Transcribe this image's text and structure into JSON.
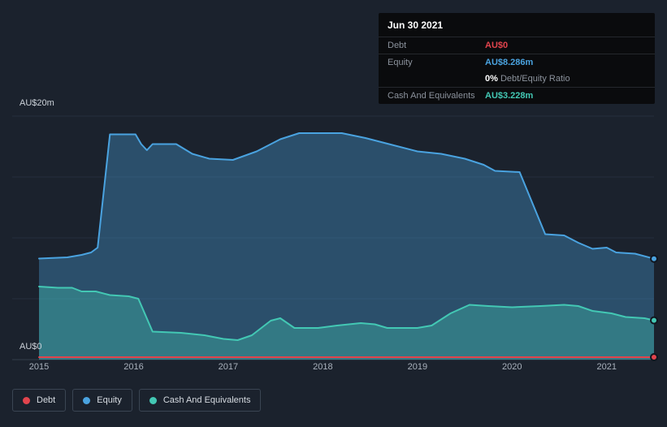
{
  "tooltip": {
    "date": "Jun 30 2021",
    "debt_label": "Debt",
    "debt_value": "AU$0",
    "equity_label": "Equity",
    "equity_value": "AU$8.286m",
    "ratio_value": "0%",
    "ratio_suffix": " Debt/Equity Ratio",
    "cash_label": "Cash And Equivalents",
    "cash_value": "AU$3.228m"
  },
  "axis": {
    "y_top_label": "AU$20m",
    "y_bottom_label": "AU$0",
    "x_ticks": [
      "2015",
      "2016",
      "2017",
      "2018",
      "2019",
      "2020",
      "2021"
    ]
  },
  "legend": [
    {
      "label": "Debt",
      "color": "#e2444d"
    },
    {
      "label": "Equity",
      "color": "#4aa3e0"
    },
    {
      "label": "Cash And Equivalents",
      "color": "#43c8b4"
    }
  ],
  "chart_data": {
    "type": "area",
    "x_range": [
      2015,
      2021.5
    ],
    "ylim": [
      0,
      20
    ],
    "y_unit": "AU$m",
    "gridline_values": [
      20,
      15,
      10,
      5,
      0
    ],
    "series": [
      {
        "name": "Equity",
        "slug": "equity",
        "color": "#4aa3e0",
        "fill": "rgba(74,163,224,0.35)",
        "x": [
          2015.0,
          2015.3,
          2015.45,
          2015.55,
          2015.62,
          2015.75,
          2016.02,
          2016.08,
          2016.14,
          2016.2,
          2016.45,
          2016.62,
          2016.8,
          2017.05,
          2017.3,
          2017.55,
          2017.75,
          2018.2,
          2018.45,
          2018.7,
          2019.0,
          2019.25,
          2019.5,
          2019.7,
          2019.82,
          2020.08,
          2020.35,
          2020.55,
          2020.7,
          2020.85,
          2021.0,
          2021.1,
          2021.3,
          2021.5
        ],
        "values": [
          8.3,
          8.4,
          8.6,
          8.8,
          9.2,
          18.5,
          18.5,
          17.7,
          17.2,
          17.7,
          17.7,
          16.9,
          16.5,
          16.4,
          17.1,
          18.1,
          18.6,
          18.6,
          18.2,
          17.7,
          17.1,
          16.9,
          16.5,
          16.0,
          15.5,
          15.4,
          10.3,
          10.2,
          9.6,
          9.1,
          9.2,
          8.8,
          8.7,
          8.286
        ]
      },
      {
        "name": "Cash And Equivalents",
        "slug": "cash",
        "color": "#43c8b4",
        "fill": "rgba(67,200,180,0.35)",
        "x": [
          2015.0,
          2015.2,
          2015.35,
          2015.45,
          2015.6,
          2015.75,
          2015.95,
          2016.05,
          2016.2,
          2016.5,
          2016.75,
          2016.95,
          2017.1,
          2017.25,
          2017.45,
          2017.55,
          2017.7,
          2017.95,
          2018.15,
          2018.4,
          2018.55,
          2018.68,
          2019.0,
          2019.15,
          2019.35,
          2019.55,
          2019.75,
          2020.0,
          2020.3,
          2020.55,
          2020.7,
          2020.85,
          2021.05,
          2021.2,
          2021.4,
          2021.5
        ],
        "values": [
          6.0,
          5.9,
          5.9,
          5.6,
          5.6,
          5.3,
          5.2,
          5.0,
          2.3,
          2.2,
          2.0,
          1.7,
          1.6,
          2.0,
          3.2,
          3.4,
          2.6,
          2.6,
          2.8,
          3.0,
          2.9,
          2.6,
          2.6,
          2.8,
          3.8,
          4.5,
          4.4,
          4.3,
          4.4,
          4.5,
          4.4,
          4.0,
          3.8,
          3.5,
          3.4,
          3.228
        ]
      },
      {
        "name": "Debt",
        "slug": "debt",
        "color": "#e2444d",
        "fill": null,
        "dy": -3,
        "x": [
          2015.0,
          2021.5
        ],
        "values": [
          0,
          0
        ]
      }
    ]
  }
}
